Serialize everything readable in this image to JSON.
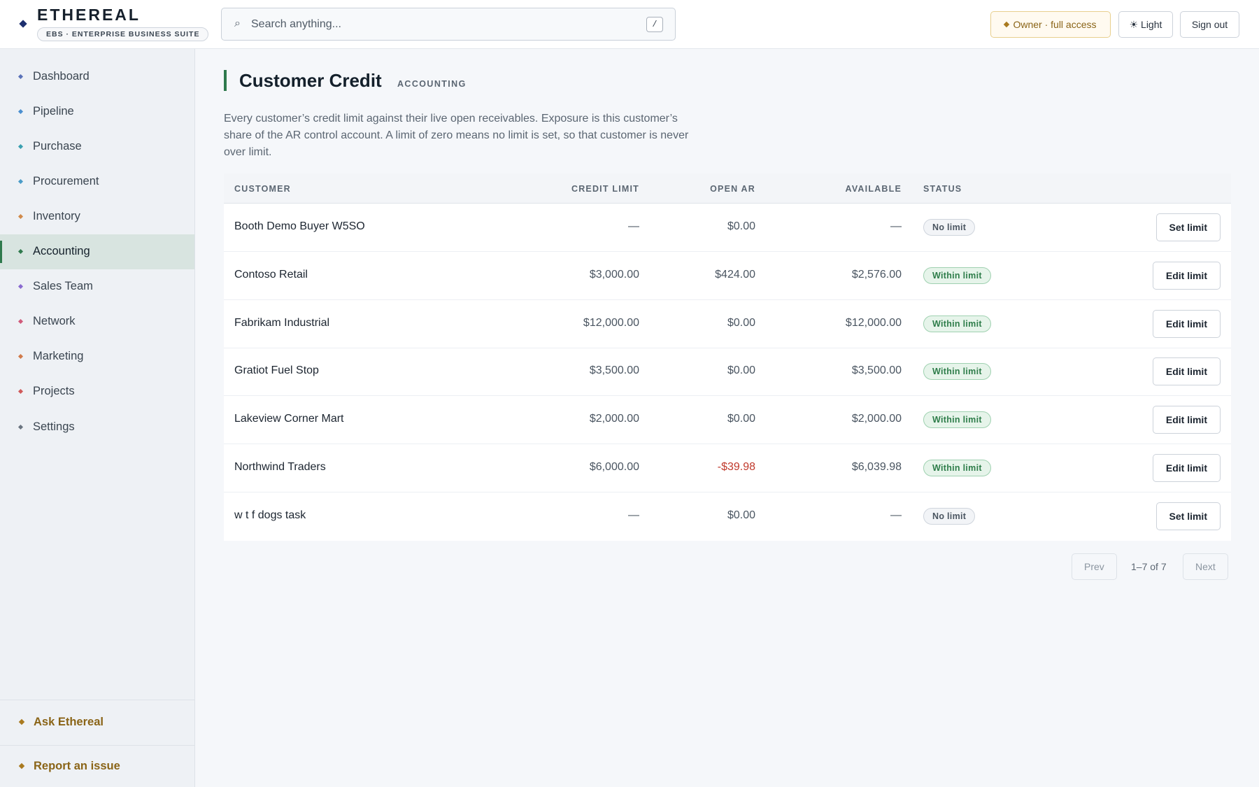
{
  "brand": {
    "name": "ETHEREAL",
    "tagline": "EBS · ENTERPRISE BUSINESS SUITE"
  },
  "search": {
    "placeholder": "Search anything...",
    "shortcut": "/"
  },
  "header_actions": {
    "owner_label": "Owner · full access",
    "theme_label": "☀ Light",
    "signout_label": "Sign out"
  },
  "sidebar": {
    "items": [
      {
        "label": "Dashboard",
        "dot": "#5a72b8"
      },
      {
        "label": "Pipeline",
        "dot": "#4a8fd0"
      },
      {
        "label": "Purchase",
        "dot": "#3aa0b0"
      },
      {
        "label": "Procurement",
        "dot": "#4a9cc8"
      },
      {
        "label": "Inventory",
        "dot": "#d08a4a"
      },
      {
        "label": "Accounting",
        "dot": "#2f7a4d",
        "active": true
      },
      {
        "label": "Sales Team",
        "dot": "#8a6ad0"
      },
      {
        "label": "Network",
        "dot": "#d05a7a"
      },
      {
        "label": "Marketing",
        "dot": "#d07a4a"
      },
      {
        "label": "Projects",
        "dot": "#d05a5a"
      },
      {
        "label": "Settings",
        "dot": "#6a7480"
      }
    ],
    "ask_label": "Ask Ethereal",
    "report_label": "Report an issue"
  },
  "page": {
    "title": "Customer Credit",
    "section": "ACCOUNTING",
    "description": "Every customer’s credit limit against their live open receivables. Exposure is this customer’s share of the AR control account. A limit of zero means no limit is set, so that customer is never over limit."
  },
  "table": {
    "headers": {
      "customer": "CUSTOMER",
      "credit_limit": "CREDIT LIMIT",
      "open_ar": "OPEN AR",
      "available": "AVAILABLE",
      "status": "STATUS"
    },
    "rows": [
      {
        "customer": "Booth Demo Buyer W5SO",
        "credit_limit": "—",
        "open_ar": "$0.00",
        "available": "—",
        "status": "No limit",
        "status_kind": "none",
        "action": "Set limit"
      },
      {
        "customer": "Contoso Retail",
        "credit_limit": "$3,000.00",
        "open_ar": "$424.00",
        "available": "$2,576.00",
        "status": "Within limit",
        "status_kind": "within",
        "action": "Edit limit"
      },
      {
        "customer": "Fabrikam Industrial",
        "credit_limit": "$12,000.00",
        "open_ar": "$0.00",
        "available": "$12,000.00",
        "status": "Within limit",
        "status_kind": "within",
        "action": "Edit limit"
      },
      {
        "customer": "Gratiot Fuel Stop",
        "credit_limit": "$3,500.00",
        "open_ar": "$0.00",
        "available": "$3,500.00",
        "status": "Within limit",
        "status_kind": "within",
        "action": "Edit limit"
      },
      {
        "customer": "Lakeview Corner Mart",
        "credit_limit": "$2,000.00",
        "open_ar": "$0.00",
        "available": "$2,000.00",
        "status": "Within limit",
        "status_kind": "within",
        "action": "Edit limit"
      },
      {
        "customer": "Northwind Traders",
        "credit_limit": "$6,000.00",
        "open_ar": "-$39.98",
        "available": "$6,039.98",
        "status": "Within limit",
        "status_kind": "within",
        "action": "Edit limit",
        "negative_ar": true
      },
      {
        "customer": "w t f dogs task",
        "credit_limit": "—",
        "open_ar": "$0.00",
        "available": "—",
        "status": "No limit",
        "status_kind": "none",
        "action": "Set limit"
      }
    ]
  },
  "pagination": {
    "prev_label": "Prev",
    "info": "1–7 of 7",
    "next_label": "Next"
  }
}
